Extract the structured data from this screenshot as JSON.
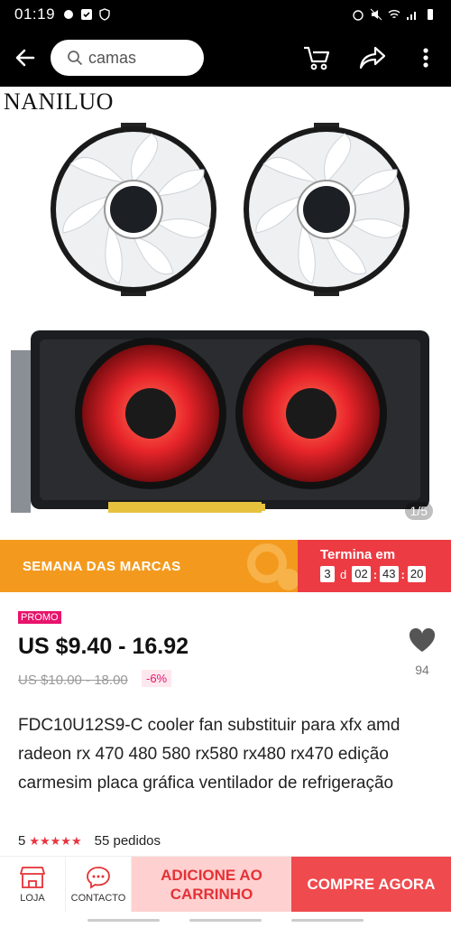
{
  "status_bar": {
    "time": "01:19"
  },
  "search": {
    "query": "camas"
  },
  "gallery": {
    "brand": "NANILUO",
    "page_indicator": "1/5"
  },
  "banner": {
    "title": "SEMANA DAS MARCAS",
    "countdown_label": "Termina em",
    "days": "3",
    "day_unit": "d",
    "hours": "02",
    "minutes": "43",
    "seconds": "20"
  },
  "product": {
    "promo_tag": "PROMO",
    "price": "US $9.40 - 16.92",
    "old_price": "US $10.00 - 18.00",
    "discount": "-6%",
    "wishlist_count": "94",
    "title": "FDC10U12S9-C cooler fan substituir para xfx amd radeon rx 470 480 580 rx580 rx480 rx470 edição carmesim placa gráfica ventilador de refrigeração",
    "rating": "5",
    "stars": "★★★★★",
    "orders": "55 pedidos"
  },
  "bottom_bar": {
    "store_label": "LOJA",
    "contact_label": "CONTACTO",
    "add_to_cart": "ADICIONE AO CARRINHO",
    "buy_now": "COMPRE AGORA"
  },
  "colors": {
    "banner_orange": "#f39a1e",
    "countdown_red": "#ec3b43",
    "promo_pink": "#e8146c",
    "add_cart_bg": "#fed0cf",
    "buy_now_bg": "#ef4a4e"
  }
}
